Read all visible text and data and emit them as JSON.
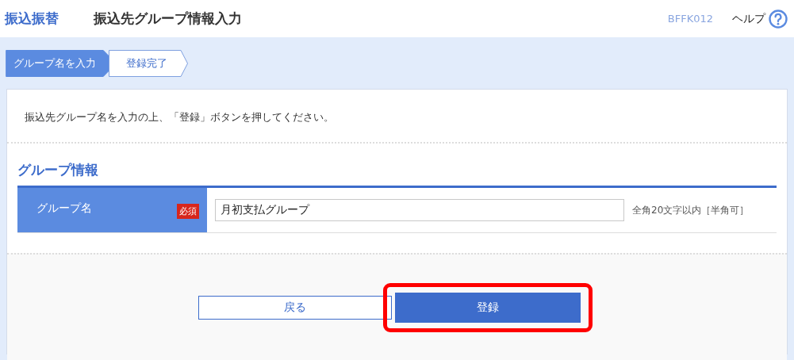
{
  "header": {
    "section": "振込振替",
    "title": "振込先グループ情報入力",
    "screen_id": "BFFK012",
    "help": "ヘルプ"
  },
  "steps": [
    {
      "label": "グループ名を入力",
      "selected": true
    },
    {
      "label": "登録完了",
      "selected": false
    }
  ],
  "instruction": "振込先グループ名を入力の上、「登録」ボタンを押してください。",
  "section_title": "グループ情報",
  "fields": [
    {
      "label": "グループ名",
      "required": true,
      "required_badge": "必須",
      "value": "月初支払グループ",
      "hint": "全角20文字以内［半角可］"
    }
  ],
  "buttons": [
    {
      "label": "戻る",
      "kind": "secondary",
      "highlighted": false
    },
    {
      "label": "登録",
      "kind": "primary",
      "highlighted": true
    }
  ]
}
